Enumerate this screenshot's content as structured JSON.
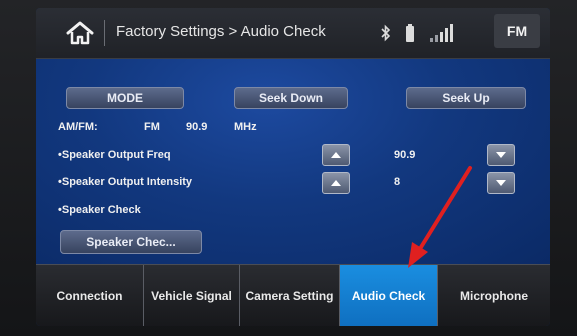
{
  "header": {
    "breadcrumb": "Factory Settings > Audio Check",
    "band": "FM"
  },
  "controls": {
    "mode_label": "MODE",
    "seek_down_label": "Seek Down",
    "seek_up_label": "Seek Up",
    "speaker_check_button_label": "Speaker Chec..."
  },
  "tuner": {
    "band_label": "AM/FM:",
    "band_value": "FM",
    "frequency": "90.9",
    "unit": "MHz"
  },
  "settings": {
    "output_freq_label": "•Speaker Output Freq",
    "output_freq_value": "90.9",
    "output_intensity_label": "•Speaker Output Intensity",
    "output_intensity_value": "8",
    "speaker_check_label": "•Speaker Check"
  },
  "tabs": [
    {
      "label": "Connection"
    },
    {
      "label": "Vehicle Signal"
    },
    {
      "label": "Camera Setting"
    },
    {
      "label": "Audio Check",
      "active": true
    },
    {
      "label": "Microphone"
    }
  ],
  "icons": {
    "home": "home-icon",
    "bluetooth": "bluetooth-icon",
    "battery": "battery-icon",
    "signal": "signal-strength-icon",
    "up": "arrow-up-icon",
    "down": "arrow-down-icon"
  },
  "colors": {
    "screen_bg": "#0c2a63",
    "active_tab": "#1a8ee0",
    "annotation_arrow": "#e02020"
  }
}
